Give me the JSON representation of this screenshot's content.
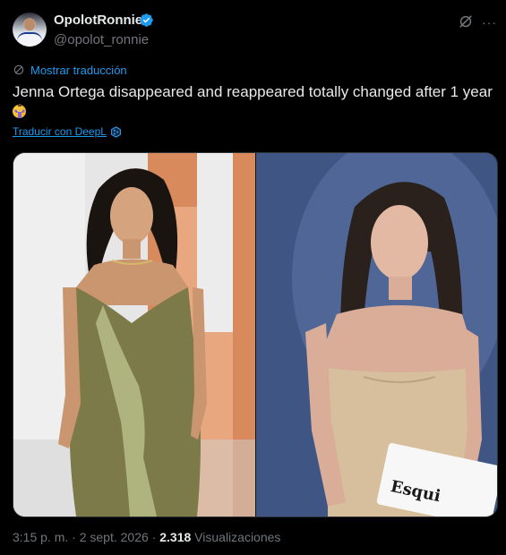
{
  "author": {
    "display_name": "OpolotRonnie",
    "handle": "@opolot_ronnie",
    "verified": true
  },
  "translation": {
    "show_label": "Mostrar traducción",
    "deepl_label": "Traducir con DeepL"
  },
  "tweet": {
    "text": "Jenna Ortega disappeared and reappeared totally changed after 1 year"
  },
  "media": {
    "sign_text": "Esqui"
  },
  "meta": {
    "time": "3:15 p. m.",
    "separator": "·",
    "date": "2 sept. 2026",
    "views_count": "2.318",
    "views_label": "Visualizaciones"
  },
  "colors": {
    "accent": "#1d9bf0",
    "muted": "#71767b",
    "text": "#e7e9ea",
    "background": "#000000"
  }
}
